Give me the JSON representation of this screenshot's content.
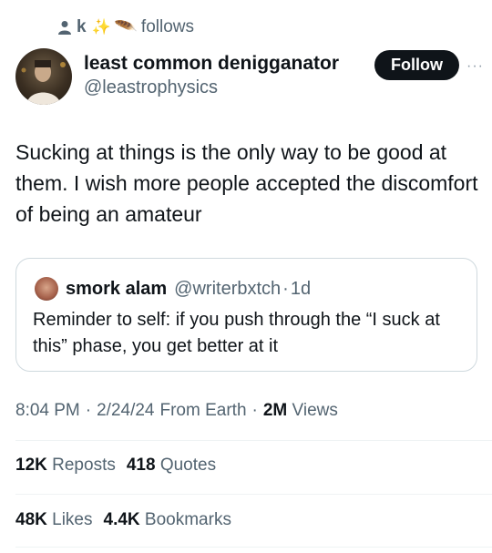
{
  "social_context": {
    "name": "k",
    "emoji": [
      "✨",
      "🪶"
    ],
    "suffix": "follows"
  },
  "author": {
    "display_name": "least common denigganator",
    "handle": "@leastrophysics"
  },
  "follow_label": "Follow",
  "more_label": "···",
  "tweet_text": "Sucking at things is the only way to be good at them. I wish more people accepted the discomfort of being an amateur",
  "quote": {
    "name": "smork alam",
    "handle": "@writerbxtch",
    "dot": "·",
    "time": "1d",
    "text": "Reminder to self: if you push through the “I suck at this” phase, you get better at it"
  },
  "meta": {
    "time": "8:04 PM",
    "date": "2/24/24",
    "source": "From Earth",
    "separator": "·",
    "views_count": "2M",
    "views_label": "Views"
  },
  "stats": {
    "reposts_count": "12K",
    "reposts_label": "Reposts",
    "quotes_count": "418",
    "quotes_label": "Quotes",
    "likes_count": "48K",
    "likes_label": "Likes",
    "bookmarks_count": "4.4K",
    "bookmarks_label": "Bookmarks"
  },
  "colors": {
    "text": "#0f1419",
    "secondary": "#536471",
    "border": "#cfd9de",
    "follow_bg": "#0f1419"
  }
}
